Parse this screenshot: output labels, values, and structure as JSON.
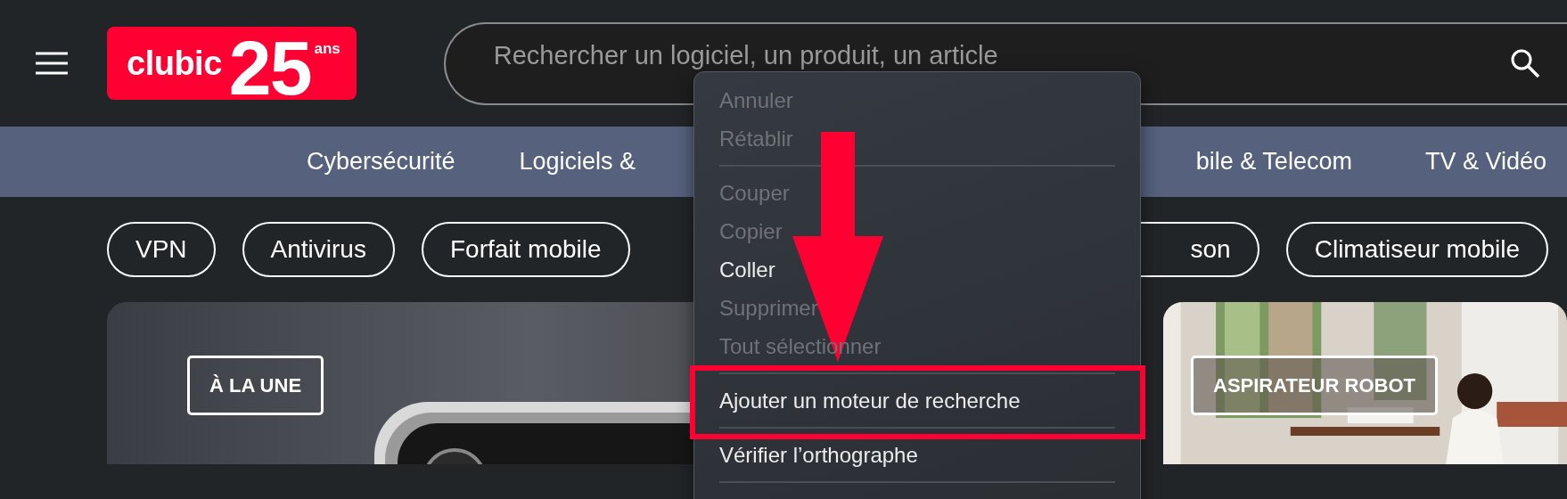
{
  "header": {
    "logo": {
      "name": "clubic",
      "number": "25",
      "suffix": "ans"
    },
    "search": {
      "placeholder": "Rechercher un logiciel, un produit, un article"
    }
  },
  "nav": {
    "left": [
      "Cybersécurité",
      "Logiciels &"
    ],
    "right": [
      "bile & Telecom",
      "TV & Vidéo"
    ]
  },
  "chips": {
    "left": [
      "VPN",
      "Antivirus",
      "Forfait mobile"
    ],
    "right": [
      "son",
      "Climatiseur mobile"
    ]
  },
  "cards": [
    {
      "tag": "À LA UNE",
      "kind": "device"
    },
    {
      "tag": "ASPIRATEUR ROBOT",
      "kind": "room"
    }
  ],
  "context_menu": [
    {
      "kind": "item",
      "label": "Annuler",
      "disabled": true,
      "highlighted": false
    },
    {
      "kind": "item",
      "label": "Rétablir",
      "disabled": true,
      "highlighted": false
    },
    {
      "kind": "separator"
    },
    {
      "kind": "item",
      "label": "Couper",
      "disabled": true,
      "highlighted": false
    },
    {
      "kind": "item",
      "label": "Copier",
      "disabled": true,
      "highlighted": false
    },
    {
      "kind": "item",
      "label": "Coller",
      "disabled": false,
      "highlighted": false
    },
    {
      "kind": "item",
      "label": "Supprimer",
      "disabled": true,
      "highlighted": false
    },
    {
      "kind": "item",
      "label": "Tout sélectionner",
      "disabled": true,
      "highlighted": false
    },
    {
      "kind": "separator"
    },
    {
      "kind": "item",
      "label": "Ajouter un moteur de recherche",
      "disabled": false,
      "highlighted": true
    },
    {
      "kind": "separator"
    },
    {
      "kind": "item",
      "label": "Vérifier l’orthographe",
      "disabled": false,
      "highlighted": false
    },
    {
      "kind": "separator"
    }
  ]
}
